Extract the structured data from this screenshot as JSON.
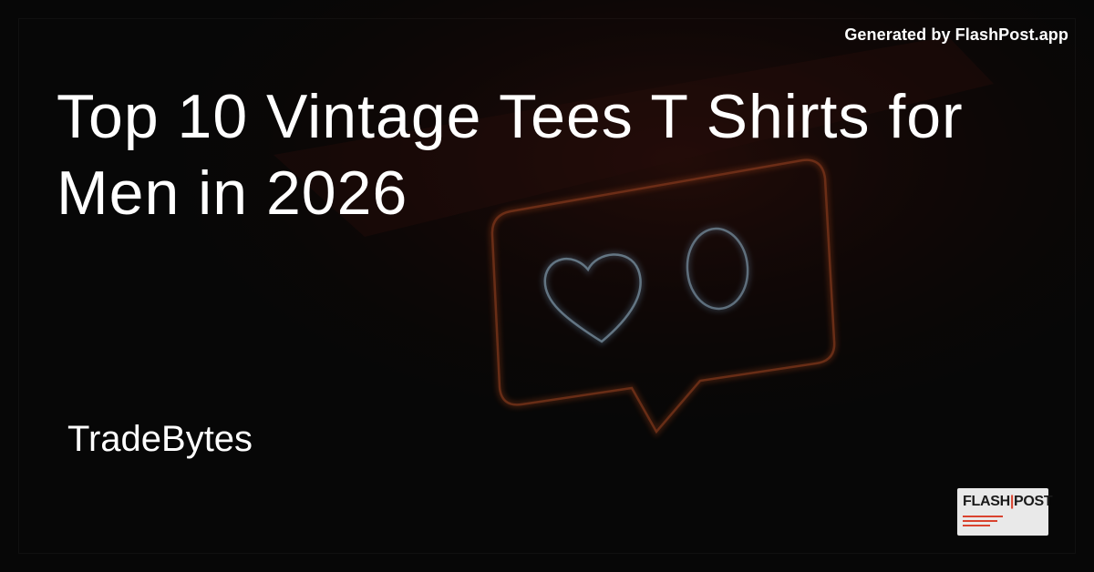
{
  "header": {
    "generated_by": "Generated by FlashPost.app"
  },
  "main": {
    "title": "Top 10 Vintage Tees T Shirts for Men in 2026",
    "author": "TradeBytes"
  },
  "background": {
    "description_icon": "neon-like-notification-sign-icon",
    "neon_counter": "0",
    "colors": {
      "background": "#0a0a0a",
      "neon_orange": "#ff6a2a",
      "neon_blue": "#9fd2ff",
      "text": "#ffffff"
    }
  },
  "logo": {
    "brand_left": "FLASH",
    "brand_right": "POST",
    "icon": "flashpost-logo-icon",
    "colors": {
      "badge": "#e9e9e9",
      "accent": "#d9432f"
    }
  }
}
